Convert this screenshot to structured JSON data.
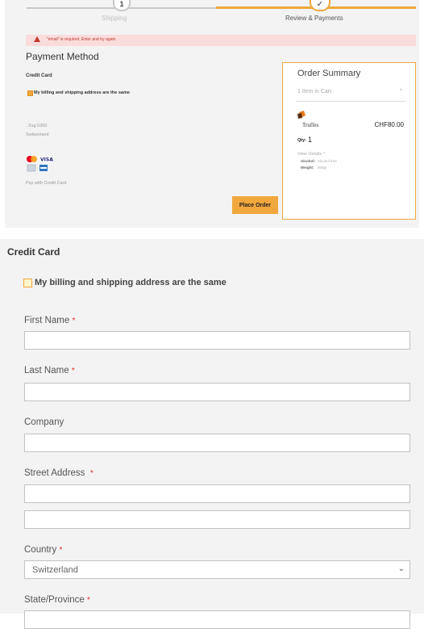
{
  "progress": {
    "step1_number": "1",
    "step1_label": "Shipping",
    "step2_check": "✓",
    "step2_label": "Review & Payments"
  },
  "error": {
    "message": "\"email\" is required. Enter and try again."
  },
  "payment": {
    "title": "Payment Method",
    "method_label": "Credit Card",
    "same_address_label": "My billing and shipping address are the same",
    "address_line1": ", Zug 6300",
    "address_line2": "Switzerland",
    "pay_with_label": "Pay with Credit Card",
    "place_order_label": "Place Order"
  },
  "summary": {
    "title": "Order Summary",
    "items_count": "1 Item in Cart",
    "product_name": "Truffes",
    "price": "CHF80.00",
    "qty_label": "Qty:",
    "qty_value": "1",
    "view_details": "View Details",
    "attr1_label": "Alcohol:",
    "attr1_value": "Alcohol free",
    "attr2_label": "Weight:",
    "attr2_value": "500gr"
  },
  "form": {
    "section_title": "Credit Card",
    "same_address_label": "My billing and shipping address are the same",
    "required_mark": "*",
    "first_name_label": "First Name",
    "last_name_label": "Last Name",
    "company_label": "Company",
    "street_label": "Street Address",
    "country_label": "Country",
    "country_value": "Switzerland",
    "state_label": "State/Province"
  },
  "icons": [
    "check-icon",
    "warning-icon",
    "checkbox-icon",
    "mastercard-icon",
    "visa-icon",
    "amex-icon",
    "product-thumbnail-icon",
    "chevron-up-icon",
    "chevron-down-icon"
  ],
  "colors": {
    "accent": "#f0a73c",
    "error": "#c0392b",
    "error_bg": "#fadcdc",
    "required": "#e02b27",
    "panel_bg": "#f3f3f3"
  }
}
